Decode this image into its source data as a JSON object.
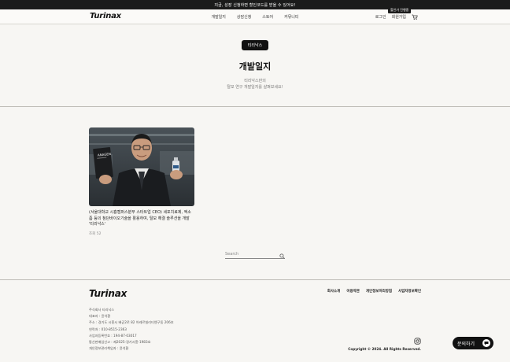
{
  "topbar": {
    "text": "지금, 성장 신청하면 할인코드를 받을 수 있어요!"
  },
  "header": {
    "logo": "Turinax",
    "nav": [
      "개발일지",
      "상담신청",
      "스토어",
      "커뮤니티"
    ],
    "login": "로그인",
    "signup": "회원가입",
    "tooltip": "할인가 진행중"
  },
  "hero": {
    "badge": "티리낙스",
    "title": "개발일지",
    "sub_line1": "티리낙스만의",
    "sub_line2": "탈모 연구 개발일지를 살펴보세요!"
  },
  "post": {
    "title": "(서울대학교 시흥캠퍼스분부 스타트업 CEO) 세포치료제, 엑소좀 등의 첨단바이오기술을 활용하여, 탈모 해결 솔루션을 개발 '티리낙스'",
    "meta": "조회 52",
    "bottle_text": "ANAGEN"
  },
  "search": {
    "placeholder": "Search"
  },
  "footer": {
    "logo": "Turinax",
    "links": [
      "회사소개",
      "이용약관",
      "개인정보처리방침",
      "사업자정보확인"
    ],
    "info": [
      "주식회사 티리낙스",
      "대표자 : 윤석환",
      "주소 : 경기도 시흥시 배곧2로 82 아레르빌리티엔구동 206호",
      "연락처 : 010-8515-2363",
      "사업자등록번호 : 194-87-03017",
      "통신판매업신고 : 제2025-경기시흥-1983호",
      "개인정보관리책임자 : 윤석환"
    ],
    "copyright": "Copyright © 2024. All Rights Reserved."
  },
  "inquiry": {
    "label": "문의하기"
  }
}
